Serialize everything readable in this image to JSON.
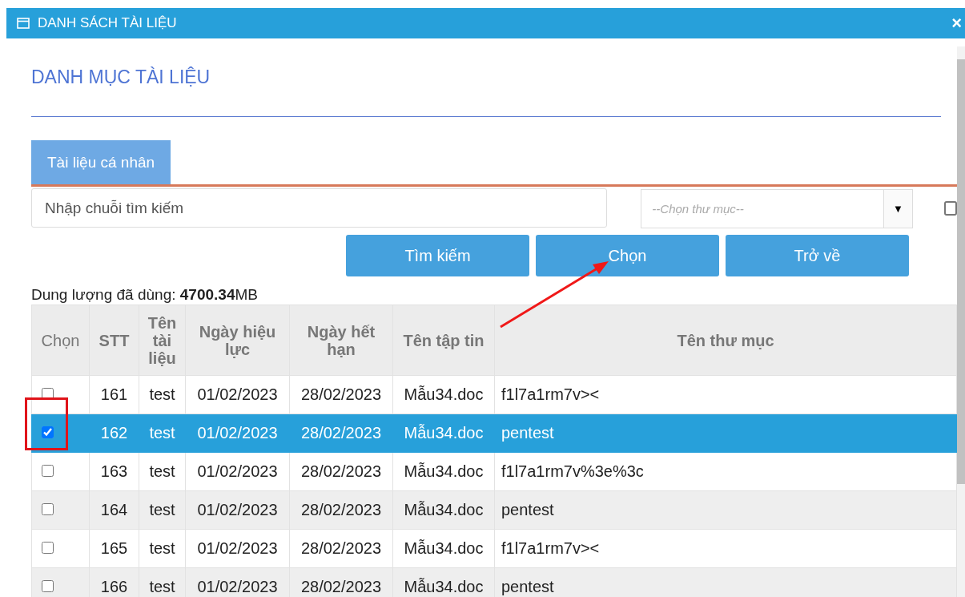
{
  "window": {
    "title": "DANH SÁCH TÀI LIỆU",
    "close": "×"
  },
  "heading": "DANH MỤC TÀI LIỆU",
  "tabs": [
    {
      "label": "Tài liệu cá nhân",
      "selected": true
    }
  ],
  "search": {
    "placeholder": "Nhập chuỗi tìm kiếm"
  },
  "folder_select": {
    "placeholder": "--Chọn thư mục--",
    "arrow": "▼"
  },
  "side_checkbox": {
    "checked": false
  },
  "buttons": [
    "Tìm kiếm",
    "Chọn",
    "Trở về"
  ],
  "usage": "Dung lượng đã dùng: **4700.34**MB",
  "table": {
    "columns": [
      {
        "label": "Chọn",
        "bold": false
      },
      {
        "label": "STT",
        "bold": true
      },
      {
        "label": "Tên tài liệu",
        "bold": true
      },
      {
        "label": "Ngày hiệu lực",
        "bold": true
      },
      {
        "label": "Ngày hết hạn",
        "bold": true
      },
      {
        "label": "Tên tập tin",
        "bold": true
      },
      {
        "label": "Tên thư mục",
        "bold": true
      }
    ],
    "rows": [
      {
        "checked": false,
        "selected": false,
        "cells": [
          "",
          "161",
          "test",
          "01/02/2023",
          "28/02/2023",
          "Mẫu34.doc",
          "f1l7a1rm7v><"
        ]
      },
      {
        "checked": true,
        "selected": true,
        "cells": [
          "",
          "162",
          "test",
          "01/02/2023",
          "28/02/2023",
          "Mẫu34.doc",
          "pentest"
        ]
      },
      {
        "checked": false,
        "selected": false,
        "cells": [
          "",
          "163",
          "test",
          "01/02/2023",
          "28/02/2023",
          "Mẫu34.doc",
          "f1l7a1rm7v%3e%3c"
        ]
      },
      {
        "checked": false,
        "selected": false,
        "cells": [
          "",
          "164",
          "test",
          "01/02/2023",
          "28/02/2023",
          "Mẫu34.doc",
          "pentest"
        ]
      },
      {
        "checked": false,
        "selected": false,
        "cells": [
          "",
          "165",
          "test",
          "01/02/2023",
          "28/02/2023",
          "Mẫu34.doc",
          "f1l7a1rm7v><"
        ]
      },
      {
        "checked": false,
        "selected": false,
        "cells": [
          "",
          "166",
          "test",
          "01/02/2023",
          "28/02/2023",
          "Mẫu34.doc",
          "pentest"
        ]
      }
    ]
  }
}
